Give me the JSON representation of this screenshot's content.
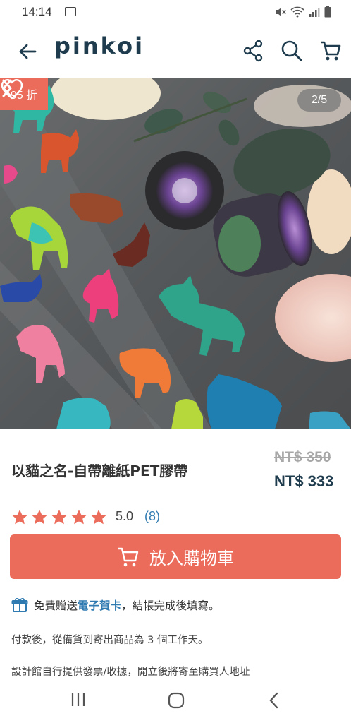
{
  "status": {
    "time": "14:14"
  },
  "brand": {
    "logo_text": "pinkoi",
    "accent": "#ec6c5c",
    "navy": "#1e3c4d"
  },
  "gallery": {
    "discount_badge": "95 折",
    "counter": "2/5"
  },
  "product": {
    "title": "以貓之名-自帶離紙PET膠帶",
    "original_price": "NT$ 350",
    "price": "NT$ 333",
    "rating": "5.0",
    "review_count": "(8)",
    "stars": 5
  },
  "cta": {
    "add_to_cart": "放入購物車"
  },
  "notes": {
    "gift_prefix": "免費贈送",
    "gift_link": "電子賀卡",
    "gift_suffix": "，結帳完成後填寫。",
    "shipping": "付款後，從備貨到寄出商品為 3 個工作天。",
    "invoice": "設計館自行提供發票/收據，開立後將寄至購買人地址"
  }
}
